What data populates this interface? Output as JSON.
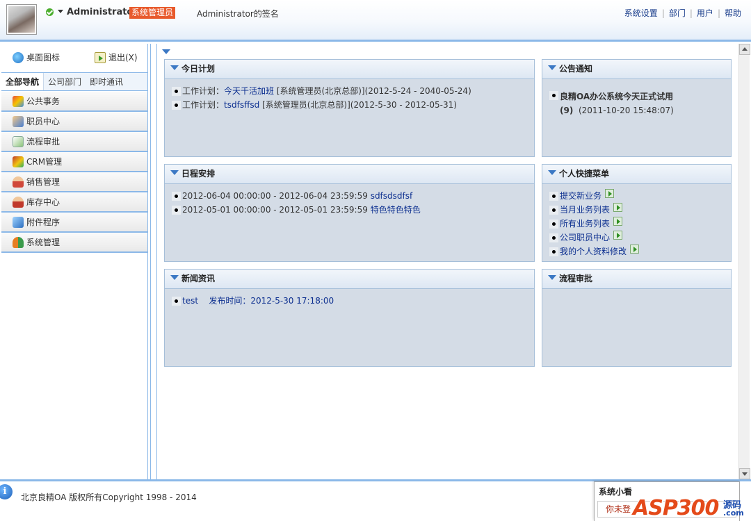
{
  "header": {
    "username": "Administrator",
    "role": "系统管理员",
    "signature": "Administrator的签名",
    "links": [
      "系统设置",
      "部门",
      "用户",
      "帮助"
    ]
  },
  "sidebar": {
    "desktop_label": "桌面图标",
    "logout_label": "退出(X)",
    "tabs": [
      "全部导航",
      "公司部门",
      "即时通讯"
    ],
    "active_tab": "全部导航",
    "items": [
      {
        "label": "公共事务",
        "icon": "public-affairs-icon"
      },
      {
        "label": "职员中心",
        "icon": "staff-center-icon"
      },
      {
        "label": "流程审批",
        "icon": "workflow-icon"
      },
      {
        "label": "CRM管理",
        "icon": "crm-icon"
      },
      {
        "label": "销售管理",
        "icon": "sales-icon"
      },
      {
        "label": "库存中心",
        "icon": "inventory-icon"
      },
      {
        "label": "附件程序",
        "icon": "attachment-program-icon"
      },
      {
        "label": "系统管理",
        "icon": "system-management-icon"
      }
    ]
  },
  "panels": {
    "today_plan": {
      "title": "今日计划",
      "items": [
        {
          "prefix": "工作计划：",
          "link": "今天千活加班",
          "suffix": "[系统管理员(北京总部)](2012-5-24 - 2040-05-24)"
        },
        {
          "prefix": "工作计划：",
          "link": "tsdfsffsd",
          "suffix": "[系统管理员(北京总部)](2012-5-30 - 2012-05-31)"
        }
      ]
    },
    "announcements": {
      "title": "公告通知",
      "items": [
        {
          "title": "良精OA办公系统今天正式试用",
          "count": "(9)",
          "time": "(2011-10-20 15:48:07)"
        }
      ]
    },
    "schedule": {
      "title": "日程安排",
      "items": [
        {
          "time": "2012-06-04 00:00:00 - 2012-06-04 23:59:59",
          "link": "sdfsdsdfsf"
        },
        {
          "time": "2012-05-01 00:00:00 - 2012-05-01 23:59:59",
          "link": "特色特色特色"
        }
      ]
    },
    "shortcuts": {
      "title": "个人快捷菜单",
      "items": [
        "提交新业务",
        "当月业务列表",
        "所有业务列表",
        "公司职员中心",
        "我的个人资料修改"
      ]
    },
    "news": {
      "title": "新闻资讯",
      "items": [
        {
          "link": "test",
          "label": "发布时间：",
          "time": "2012-5-30 17:18:00"
        }
      ]
    },
    "workflow": {
      "title": "流程审批",
      "items": []
    }
  },
  "footer": {
    "copyright": "北京良精OA 版权所有Copyright 1998 - 2014",
    "notice_title": "系统小看",
    "notice_text": "你未登",
    "watermark_main": "ASP300",
    "watermark_sub1": "源码",
    "watermark_sub2": ".com"
  },
  "colors": {
    "accent": "#8bb8e8",
    "panel_bg": "#d4dce6",
    "role_badge": "#e85a2c",
    "link": "#0b2e8f",
    "watermark": "#e44a1a"
  }
}
